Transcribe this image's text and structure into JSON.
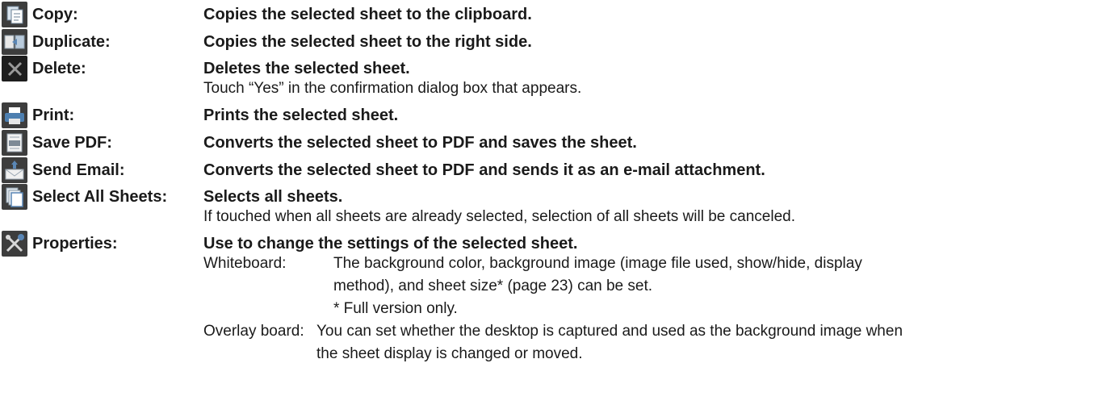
{
  "items": [
    {
      "icon": "copy-icon",
      "label": "Copy:",
      "desc": "Copies the selected sheet to the clipboard."
    },
    {
      "icon": "duplicate-icon",
      "label": "Duplicate:",
      "desc": "Copies the selected sheet to the right side."
    },
    {
      "icon": "delete-icon",
      "label": "Delete:",
      "desc": "Deletes the selected sheet.",
      "note": "Touch “Yes” in the confirmation dialog box that appears."
    },
    {
      "icon": "print-icon",
      "label": "Print:",
      "desc": "Prints the selected sheet."
    },
    {
      "icon": "save-pdf-icon",
      "label": "Save PDF:",
      "desc": "Converts the selected sheet to PDF and saves the sheet."
    },
    {
      "icon": "send-email-icon",
      "label": "Send Email:",
      "desc": "Converts the selected sheet to PDF and sends it as an e-mail attachment."
    },
    {
      "icon": "select-all-sheets-icon",
      "label": "Select All Sheets:",
      "desc": "Selects all sheets.",
      "note": "If touched when all sheets are already selected, selection of all sheets will be canceled."
    },
    {
      "icon": "properties-icon",
      "label": "Properties:",
      "desc": "Use to change the settings of the selected sheet."
    }
  ],
  "properties": {
    "whiteboard": {
      "term": "Whiteboard:",
      "lines": [
        "The background color, background image (image file used, show/hide, display",
        "method), and sheet size* (page 23) can be set.",
        "* Full version only."
      ]
    },
    "overlay": {
      "term": "Overlay board:",
      "lines": [
        "You can set whether the desktop is captured and used as the background image when",
        "the sheet display is changed or moved."
      ]
    }
  }
}
